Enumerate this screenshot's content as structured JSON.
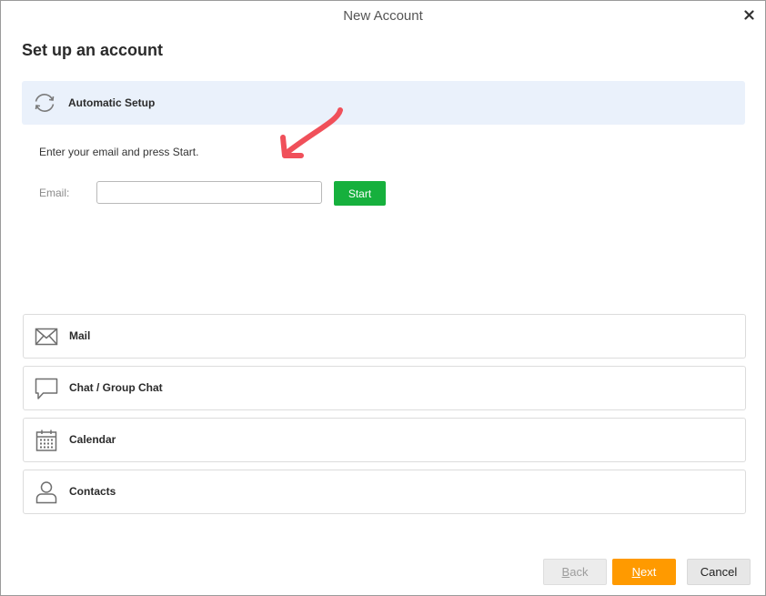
{
  "window": {
    "title": "New Account"
  },
  "page": {
    "title": "Set up an account"
  },
  "automatic_setup": {
    "label": "Automatic Setup",
    "icon": "sync-icon",
    "instruction": "Enter your email and press Start.",
    "email_label": "Email:",
    "email_value": "",
    "start_label": "Start",
    "start_color": "#16b03d"
  },
  "account_types": [
    {
      "label": "Mail",
      "icon": "mail-icon"
    },
    {
      "label": "Chat / Group Chat",
      "icon": "chat-bubble-icon"
    },
    {
      "label": "Calendar",
      "icon": "calendar-icon"
    },
    {
      "label": "Contacts",
      "icon": "person-icon"
    }
  ],
  "footer": {
    "back_mnemonic": "B",
    "back_rest": "ack",
    "next_mnemonic": "N",
    "next_rest": "ext",
    "cancel_label": "Cancel",
    "next_color": "#ff9a00"
  },
  "annotation": {
    "arrow_color": "#f0505a"
  }
}
